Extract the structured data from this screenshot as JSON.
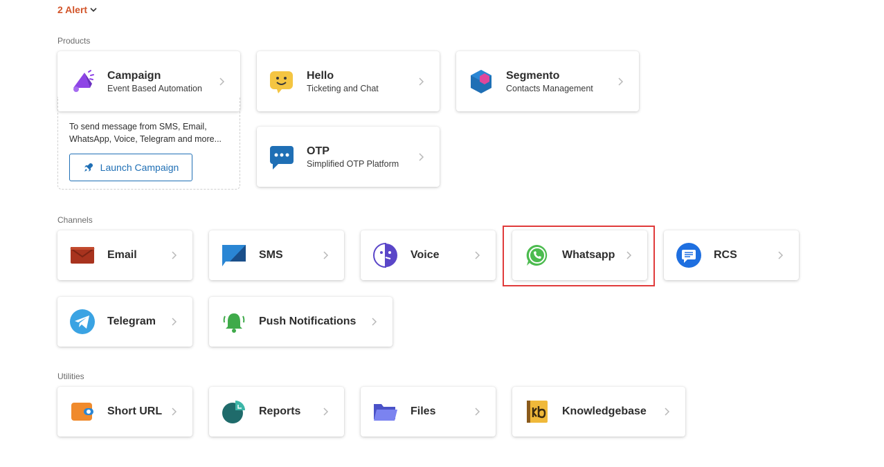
{
  "alert": {
    "label": "2 Alert"
  },
  "sections": {
    "products": "Products",
    "channels": "Channels",
    "utilities": "Utilities"
  },
  "products": {
    "campaign": {
      "name": "Campaign",
      "sub": "Event Based Automation"
    },
    "hello": {
      "name": "Hello",
      "sub": "Ticketing and Chat"
    },
    "segmento": {
      "name": "Segmento",
      "sub": "Contacts Management"
    },
    "otp": {
      "name": "OTP",
      "sub": "Simplified OTP Platform"
    }
  },
  "campaign_promo": {
    "text": "To send message from SMS, Email, WhatsApp, Voice, Telegram and more...",
    "button": "Launch Campaign"
  },
  "channels": {
    "email": "Email",
    "sms": "SMS",
    "voice": "Voice",
    "whatsapp": "Whatsapp",
    "rcs": "RCS",
    "telegram": "Telegram",
    "push": "Push Notifications"
  },
  "utilities": {
    "short_url": "Short URL",
    "reports": "Reports",
    "files": "Files",
    "knowledgebase": "Knowledgebase"
  },
  "colors": {
    "alert": "#d2552a",
    "link": "#1f6fb5",
    "highlight": "#e03a3a"
  }
}
